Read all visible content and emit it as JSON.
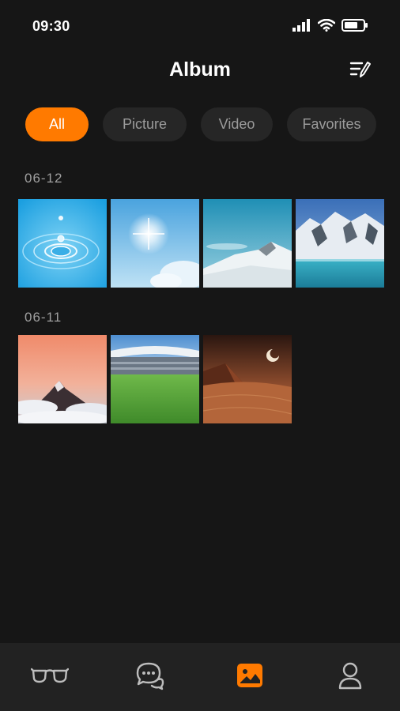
{
  "status_bar": {
    "time": "09:30",
    "icons": [
      "signal-icon",
      "wifi-icon",
      "battery-icon"
    ]
  },
  "header": {
    "title": "Album",
    "edit_icon": "edit-list-icon"
  },
  "filters": [
    {
      "label": "All",
      "active": true
    },
    {
      "label": "Picture",
      "active": false
    },
    {
      "label": "Video",
      "active": false
    },
    {
      "label": "Favorites",
      "active": false
    }
  ],
  "sections": [
    {
      "date": "06-12",
      "photos": [
        "water-drop",
        "sun-sky",
        "snowy-mountain",
        "glacier-lake"
      ]
    },
    {
      "date": "06-11",
      "photos": [
        "mountain-peak-clouds",
        "stadium",
        "desert-pyramid"
      ]
    }
  ],
  "tab_bar": {
    "tabs": [
      {
        "icon": "glasses-icon",
        "active": false
      },
      {
        "icon": "chat-icon",
        "active": false
      },
      {
        "icon": "album-icon",
        "active": true
      },
      {
        "icon": "profile-icon",
        "active": false
      }
    ]
  },
  "colors": {
    "accent": "#ff7a00",
    "background": "#161616",
    "chip_bg": "#262626",
    "tab_bar_bg": "#222222"
  }
}
